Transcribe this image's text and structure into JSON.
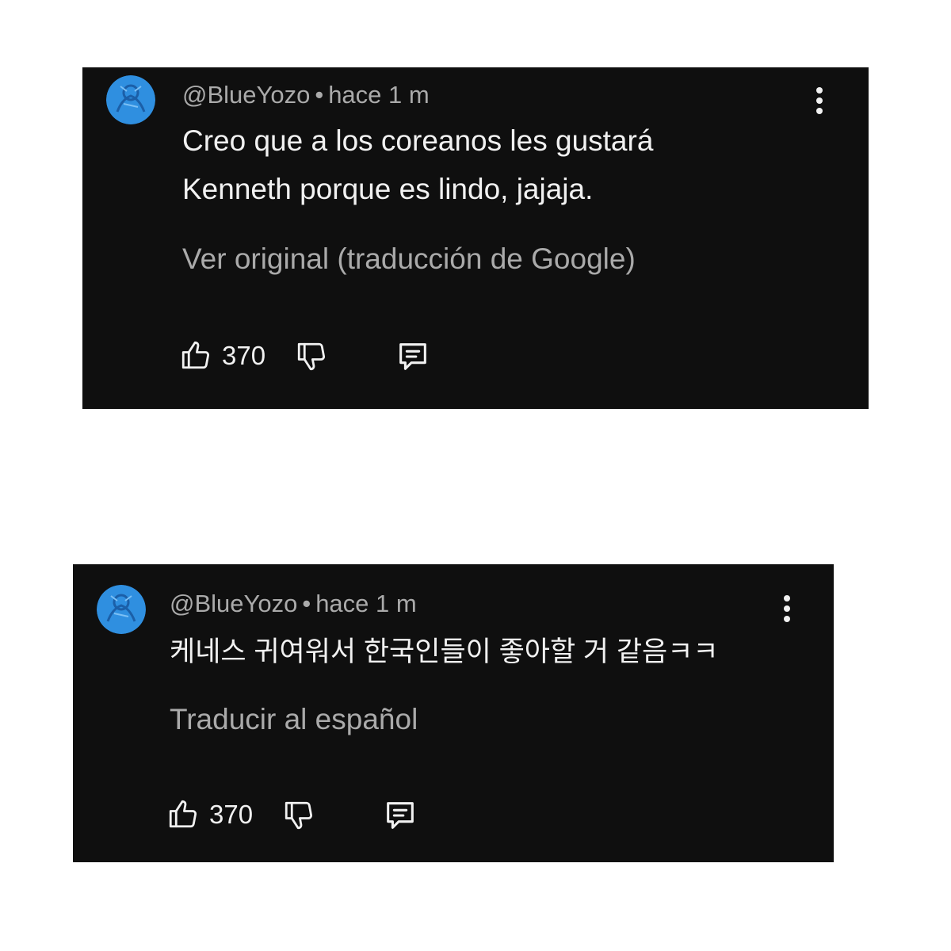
{
  "colors": {
    "card_background": "#0f0f0f",
    "page_background": "#ffffff",
    "primary_text": "#f1f1f1",
    "secondary_text": "#aaaaaa",
    "avatar_blue": "#2f8fe0"
  },
  "comments": [
    {
      "author": "@BlueYozo",
      "separator": "•",
      "time": "hace 1 m",
      "text_lines": [
        "Creo que a los coreanos les gustará",
        "Kenneth porque es lindo, jajaja."
      ],
      "translate_link": "Ver original (traducción de Google)",
      "likes": "370",
      "icons": {
        "like": "thumbs-up-icon",
        "dislike": "thumbs-down-icon",
        "reply": "comment-reply-icon",
        "menu": "more-vertical-icon"
      }
    },
    {
      "author": "@BlueYozo",
      "separator": "•",
      "time": "hace 1 m",
      "text_lines": [
        "케네스 귀여워서 한국인들이 좋아할 거 같음ㅋㅋ"
      ],
      "translate_link": "Traducir al español",
      "likes": "370",
      "icons": {
        "like": "thumbs-up-icon",
        "dislike": "thumbs-down-icon",
        "reply": "comment-reply-icon",
        "menu": "more-vertical-icon"
      }
    }
  ]
}
